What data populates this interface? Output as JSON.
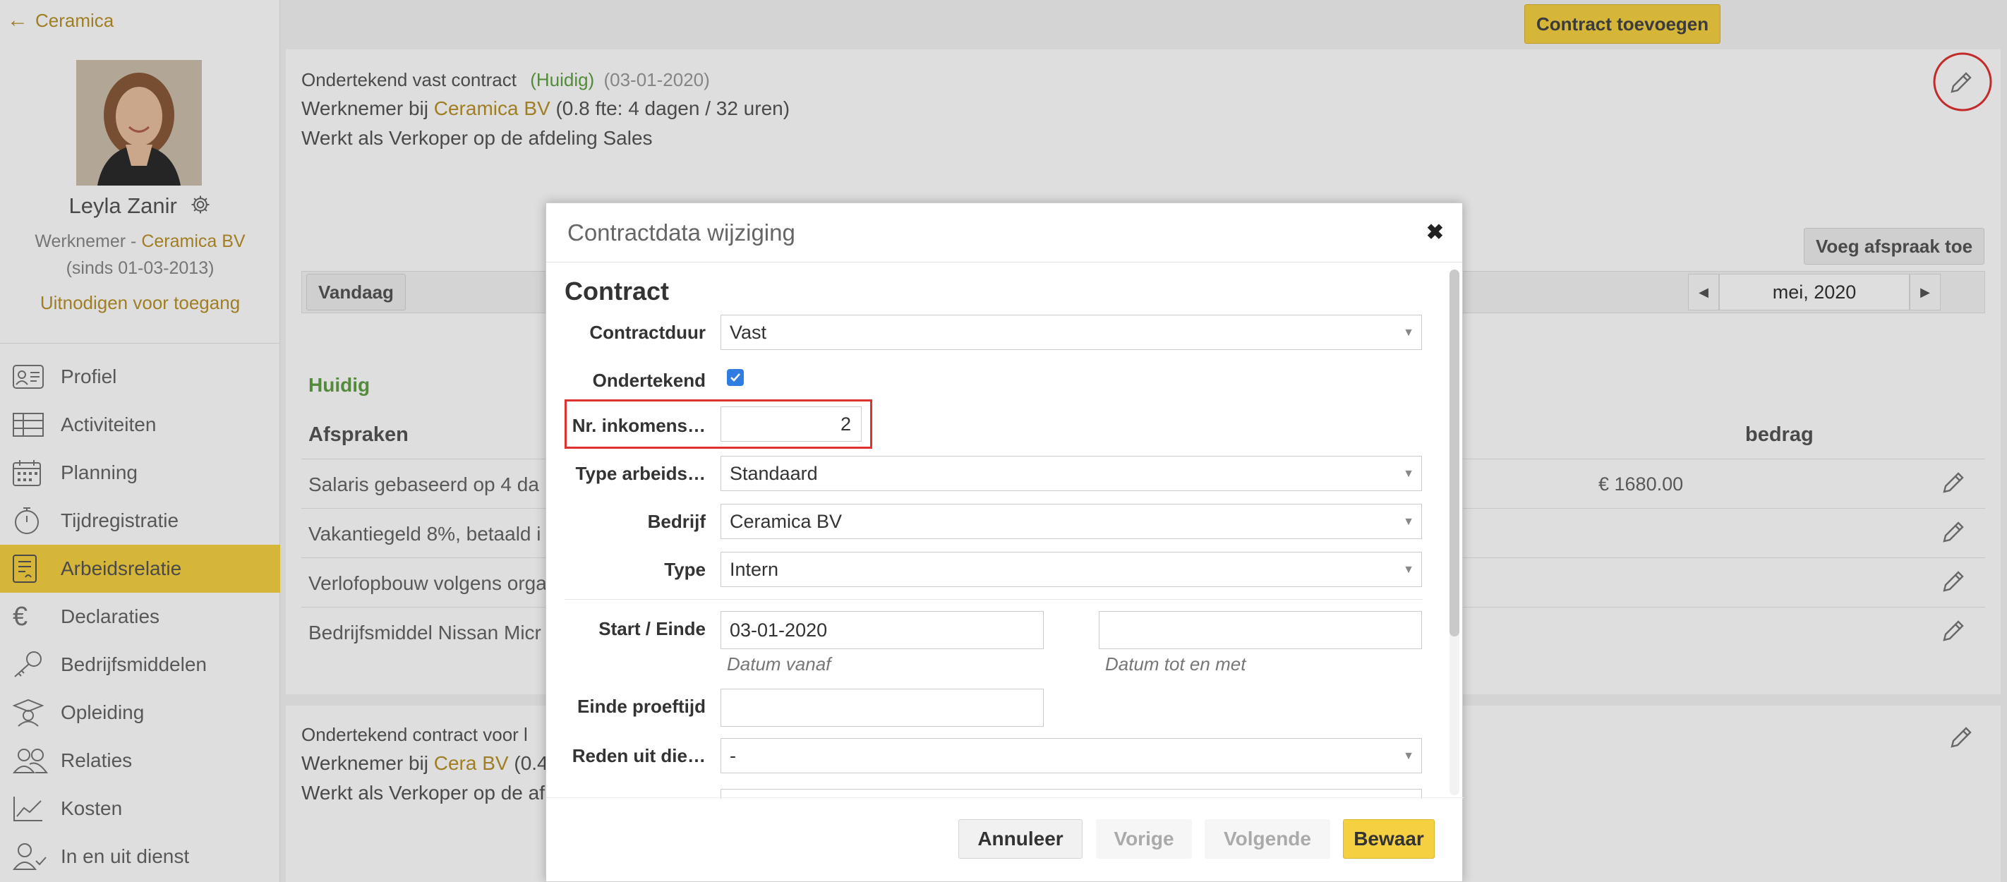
{
  "sidebar": {
    "back_label": "Ceramica",
    "profile": {
      "name": "Leyla Zanir",
      "role_prefix": "Werknemer -",
      "company": "Ceramica BV",
      "since": "(sinds 01-03-2013)",
      "invite": "Uitnodigen voor toegang"
    },
    "nav": [
      {
        "label": "Profiel",
        "icon": "id-card-icon",
        "active": false
      },
      {
        "label": "Activiteiten",
        "icon": "table-icon",
        "active": false
      },
      {
        "label": "Planning",
        "icon": "calendar-icon",
        "active": false
      },
      {
        "label": "Tijdregistratie",
        "icon": "stopwatch-icon",
        "active": false
      },
      {
        "label": "Arbeidsrelatie",
        "icon": "contract-icon",
        "active": true
      },
      {
        "label": "Declaraties",
        "icon": "euro-icon",
        "active": false
      },
      {
        "label": "Bedrijfsmiddelen",
        "icon": "key-icon",
        "active": false
      },
      {
        "label": "Opleiding",
        "icon": "graduate-icon",
        "active": false
      },
      {
        "label": "Relaties",
        "icon": "people-icon",
        "active": false
      },
      {
        "label": "Kosten",
        "icon": "chart-icon",
        "active": false
      },
      {
        "label": "In en uit dienst",
        "icon": "user-check-icon",
        "active": false
      }
    ]
  },
  "main": {
    "add_contract_label": "Contract toevoegen",
    "contract1": {
      "title": "Ondertekend vast contract",
      "status": "(Huidig)",
      "date": "(03-01-2020)",
      "line1_prefix": "Werknemer bij",
      "line1_company": "Ceramica BV",
      "line1_suffix": "(0.8 fte: 4 dagen / 32 uren)",
      "line2": "Werkt als Verkoper op de afdeling Sales",
      "add_agreement_label": "Voeg afspraak toe",
      "today_label": "Vandaag",
      "month_label": "mei, 2020",
      "section_label": "Huidig",
      "col_afspraken": "Afspraken",
      "col_bedrag": "bedrag",
      "rows": [
        {
          "text": "Salaris gebaseerd op 4 da",
          "amount": "€ 1680.00"
        },
        {
          "text": "Vakantiegeld 8%, betaald i",
          "amount": ""
        },
        {
          "text": "Verlofopbouw volgens orga",
          "amount": ""
        },
        {
          "text": "Bedrijfsmiddel Nissan Micr",
          "amount": ""
        }
      ]
    },
    "contract2": {
      "title": "Ondertekend contract voor l",
      "line1_prefix": "Werknemer bij",
      "line1_company": "Cera BV",
      "line1_suffix": "(0.4",
      "line2": "Werkt als Verkoper op de af"
    }
  },
  "modal": {
    "title": "Contractdata wijziging",
    "section": "Contract",
    "fields": {
      "contractduur_label": "Contractduur",
      "contractduur_value": "Vast",
      "ondertekend_label": "Ondertekend",
      "nr_label": "Nr. inkomens…",
      "nr_value": "2",
      "type_arbeid_label": "Type arbeids…",
      "type_arbeid_value": "Standaard",
      "bedrijf_label": "Bedrijf",
      "bedrijf_value": "Ceramica BV",
      "type_label": "Type",
      "type_value": "Intern",
      "start_einde_label": "Start / Einde",
      "start_value": "03-01-2020",
      "end_value": "",
      "start_hint": "Datum vanaf",
      "end_hint": "Datum tot en met",
      "einde_proeftijd_label": "Einde proeftijd",
      "einde_proeftijd_value": "",
      "reden_label": "Reden uit die…",
      "reden_value": "-"
    },
    "buttons": {
      "cancel": "Annuleer",
      "prev": "Vorige",
      "next": "Volgende",
      "save": "Bewaar"
    }
  },
  "colors": {
    "accent_yellow": "#f5d142",
    "link_gold": "#b8912a",
    "status_green": "#5fa043",
    "highlight_red": "#e03131",
    "checkbox_blue": "#2f7de1"
  }
}
